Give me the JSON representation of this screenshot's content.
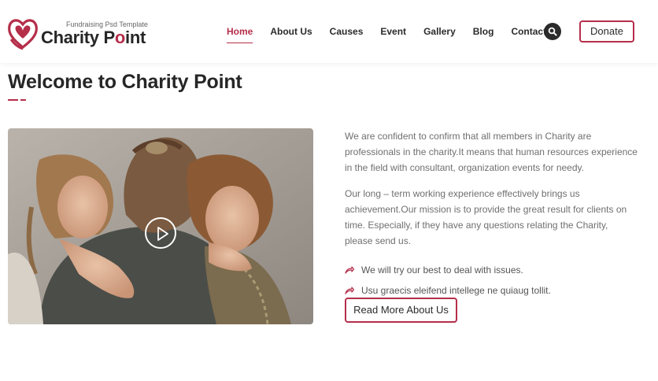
{
  "brand": {
    "tagline": "Fundraising Psd Template",
    "name_part1": "Charity P",
    "name_accent": "o",
    "name_part2": "int",
    "accent_color": "#b52e4a"
  },
  "nav": {
    "items": [
      {
        "label": "Home",
        "active": true
      },
      {
        "label": "About Us",
        "active": false
      },
      {
        "label": "Causes",
        "active": false
      },
      {
        "label": "Event",
        "active": false
      },
      {
        "label": "Gallery",
        "active": false
      },
      {
        "label": "Blog",
        "active": false
      },
      {
        "label": "Contact",
        "active": false
      }
    ],
    "search_icon": "search-icon",
    "donate_label": "Donate"
  },
  "about": {
    "title": "Welcome to Charity Point",
    "paragraphs": [
      "We are confident to confirm that all members in Charity are professionals in the charity.It means that human resources experience in the field with consultant, organization events for needy.",
      "Our long – term working experience effectively brings us achievement.Our mission is to provide the great result for clients on time. Especially, if they have any questions relating the Charity, please send us."
    ],
    "list": [
      "We will try our best to deal with issues.",
      "Usu graecis eleifend intellege ne quiaug tollit."
    ],
    "list_icon": "share-arrow-icon",
    "read_more_label": "Read More About Us",
    "video_icon": "play-icon"
  }
}
